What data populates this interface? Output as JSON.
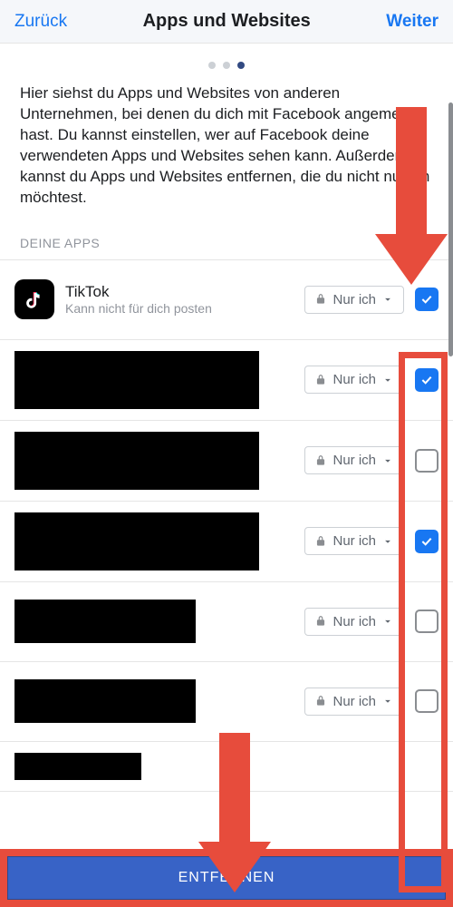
{
  "header": {
    "back": "Zurück",
    "title": "Apps und Websites",
    "next": "Weiter"
  },
  "description": "Hier siehst du Apps und Websites von anderen Unternehmen, bei denen du dich mit Facebook angemeldet hast. Du kannst einstellen, wer auf Facebook deine verwendeten Apps und Websites sehen kann. Außerdem kannst du Apps und Websites entfernen, die du nicht nutzen möchtest.",
  "section_label": "DEINE APPS",
  "privacy_label": "Nur ich",
  "apps": [
    {
      "name": "TikTok",
      "subtitle": "Kann nicht für dich posten",
      "checked": true,
      "redacted": false
    },
    {
      "name": "",
      "subtitle": "",
      "checked": true,
      "redacted": true
    },
    {
      "name": "",
      "subtitle": "",
      "checked": false,
      "redacted": true
    },
    {
      "name": "",
      "subtitle": "",
      "checked": true,
      "redacted": true
    },
    {
      "name": "",
      "subtitle": "",
      "checked": false,
      "redacted": true,
      "small": true
    },
    {
      "name": "",
      "subtitle": "",
      "checked": false,
      "redacted": true,
      "small": true
    }
  ],
  "remove_button": "ENTFERNEN"
}
